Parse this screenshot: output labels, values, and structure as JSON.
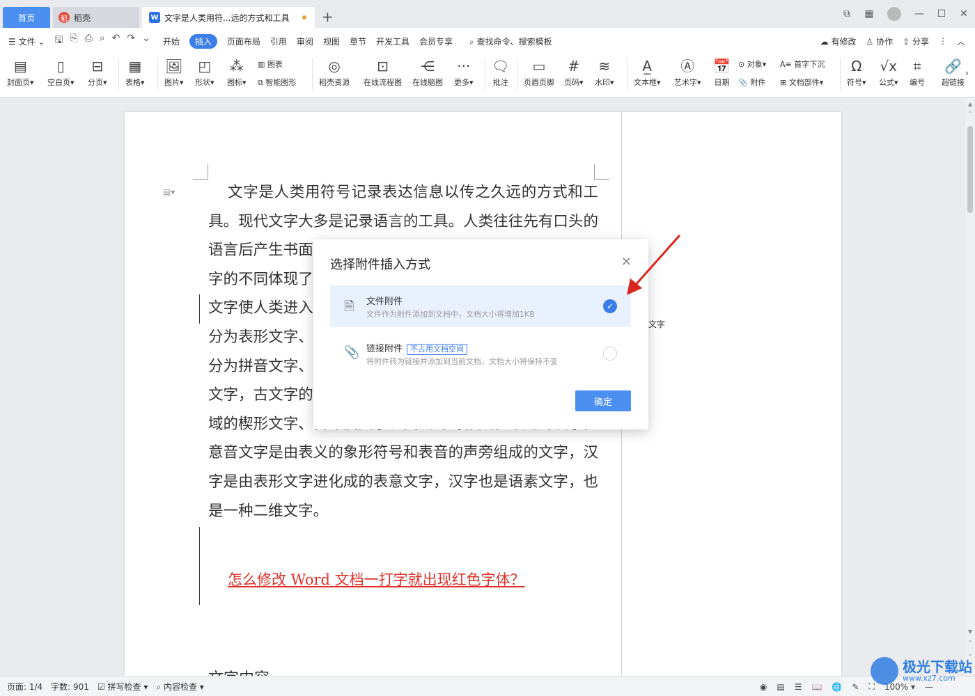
{
  "tabs": {
    "home": "首页",
    "daoke": "稻壳",
    "document": "文字是人类用符...远的方式和工具"
  },
  "menubar": {
    "file": "文件",
    "items": [
      "开始",
      "插入",
      "页面布局",
      "引用",
      "审阅",
      "视图",
      "章节",
      "开发工具",
      "会员专享"
    ],
    "active": "插入",
    "search_placeholder": "查找命令、搜索模板",
    "right": [
      "有修改",
      "协作",
      "分享"
    ]
  },
  "ribbon": {
    "cover": "封面页",
    "blank": "空白页",
    "pagebreak": "分页",
    "table": "表格",
    "picture": "图片",
    "shape": "形状",
    "icon": "图标",
    "chart": "图表",
    "smartart": "智能图形",
    "daoke_res": "稻壳资源",
    "flowchart": "在线流程图",
    "mindmap": "在线脑图",
    "more": "更多",
    "comment": "批注",
    "header_footer": "页眉页脚",
    "page_num": "页码",
    "watermark": "水印",
    "textbox": "文本框",
    "wordart": "艺术字",
    "date": "日期",
    "object": "对象",
    "attachment": "附件",
    "dropcap": "首字下沉",
    "doc_parts": "文档部件",
    "symbol": "符号",
    "formula": "公式",
    "numbering": "编号",
    "hyperlink": "超链接"
  },
  "document": {
    "body": "文字是人类用符号记录表达信息以传之久远的方式和工具。现代文字大多是记录语言的工具。人类往往先有口头的语言后产生书面文字，很多小语种，有语言但没有文字。文字的不同体现了国家和民族的书面表达的方式和思维不同。文字使人类进入有历史记录的文明社会。世界上的文字可以分为表形文字、表音文字和意音文字。按语音和字形，可以分为拼音文字、音节文字和语素文字。表形文字是最古老的文字，古文字的象形文字，比如：古埃及的圣书字、两河流域的楔形文字、古印度文字、美洲的玛雅文和早期的汉字。意音文字是由表义的象形符号和表音的声旁组成的文字，汉字是由表形文字进化成的表意文字，汉字也是语素文字，也是一种二维文字。",
    "link_text": "怎么修改 Word 文档一打字就出现红色字体？",
    "next_heading": "文字内容",
    "side_note": "文字"
  },
  "dialog": {
    "title": "选择附件插入方式",
    "option1_name": "文件附件",
    "option1_desc": "文件作为附件添加到文档中，文档大小将增加1KB",
    "option2_name": "链接附件",
    "option2_badge": "不占用文档空间",
    "option2_desc": "将附件转为链接并添加到当前文档，文档大小将保持不变",
    "ok": "确定",
    "selected": "option1"
  },
  "status": {
    "page": "页面: 1/4",
    "words": "字数: 901",
    "spell": "拼写检查",
    "content": "内容检查",
    "zoom": "100%"
  },
  "watermark": {
    "title": "极光下载站",
    "url": "www.xz7.com"
  },
  "colors": {
    "accent": "#3b7de9",
    "link_red": "#e0302a",
    "arrow_red": "#d9251c"
  }
}
